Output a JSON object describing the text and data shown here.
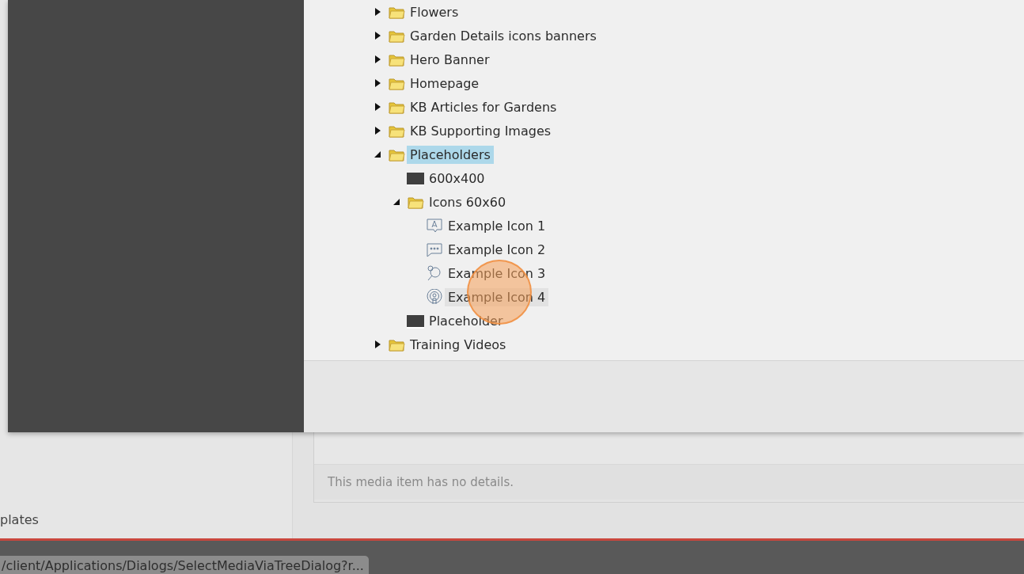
{
  "media_tree": [
    {
      "label": "Flowers",
      "kind": "folder",
      "expanded": false,
      "selected": false,
      "hovered": false
    },
    {
      "label": "Garden Details icons banners",
      "kind": "folder",
      "expanded": false,
      "selected": false,
      "hovered": false
    },
    {
      "label": "Hero Banner",
      "kind": "folder",
      "expanded": false,
      "selected": false,
      "hovered": false
    },
    {
      "label": "Homepage",
      "kind": "folder",
      "expanded": false,
      "selected": false,
      "hovered": false
    },
    {
      "label": "KB Articles for Gardens",
      "kind": "folder",
      "expanded": false,
      "selected": false,
      "hovered": false
    },
    {
      "label": "KB Supporting Images",
      "kind": "folder",
      "expanded": false,
      "selected": false,
      "hovered": false
    },
    {
      "label": "Placeholders",
      "kind": "folder",
      "expanded": true,
      "selected": true,
      "hovered": false,
      "children": [
        {
          "label": "600x400",
          "kind": "image",
          "selected": false,
          "hovered": false
        },
        {
          "label": "Icons 60x60",
          "kind": "folder",
          "expanded": true,
          "selected": false,
          "hovered": false,
          "children": [
            {
              "label": "Example Icon 1",
              "kind": "letter",
              "selected": false,
              "hovered": false
            },
            {
              "label": "Example Icon 2",
              "kind": "chat",
              "selected": false,
              "hovered": false
            },
            {
              "label": "Example Icon 3",
              "kind": "magnifier",
              "selected": false,
              "hovered": false
            },
            {
              "label": "Example Icon 4",
              "kind": "broadcast",
              "selected": false,
              "hovered": true
            }
          ]
        },
        {
          "label": "Placeholder",
          "kind": "image",
          "selected": false,
          "hovered": false
        }
      ]
    },
    {
      "label": "Training Videos",
      "kind": "folder",
      "expanded": false,
      "selected": false,
      "hovered": false
    }
  ],
  "sidebar_item": "plates",
  "details": {
    "message": "This media item has no details."
  },
  "status_url": "/client/Applications/Dialogs/SelectMediaViaTreeDialog?r..."
}
